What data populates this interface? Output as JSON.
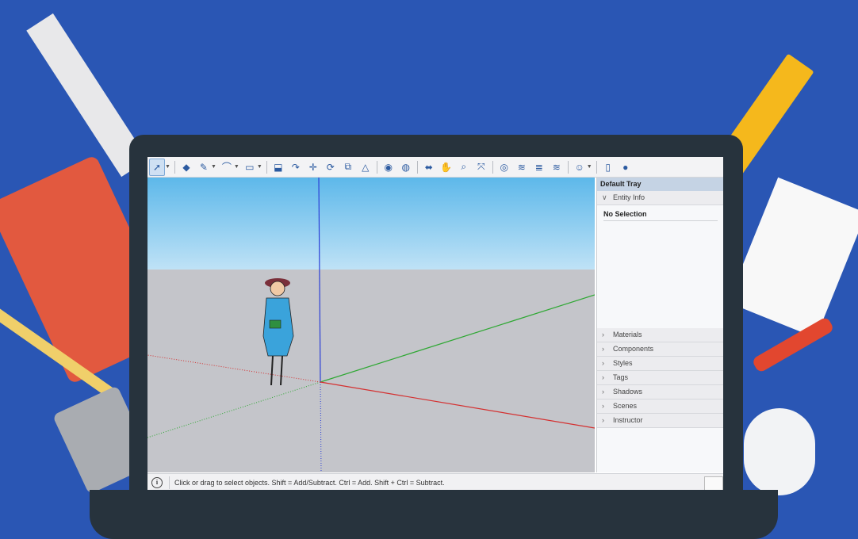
{
  "toolbar": {
    "tools": [
      {
        "name": "select-tool-icon",
        "glyph": "➚"
      },
      {
        "name": "eraser-tool-icon",
        "glyph": "◆"
      },
      {
        "name": "pencil-line-tool-icon",
        "glyph": "✎"
      },
      {
        "name": "arc-tool-icon",
        "glyph": "⌒"
      },
      {
        "name": "rectangle-tool-icon",
        "glyph": "▭"
      },
      {
        "name": "push-pull-tool-icon",
        "glyph": "⬓"
      },
      {
        "name": "follow-me-tool-icon",
        "glyph": "↷"
      },
      {
        "name": "move-tool-icon",
        "glyph": "✛"
      },
      {
        "name": "rotate-tool-icon",
        "glyph": "⟳"
      },
      {
        "name": "scale-tool-icon",
        "glyph": "⧉"
      },
      {
        "name": "offset-tool-icon",
        "glyph": "△"
      },
      {
        "name": "tape-measure-tool-icon",
        "glyph": "◉"
      },
      {
        "name": "paint-bucket-tool-icon",
        "glyph": "◍"
      },
      {
        "name": "orbit-tool-icon",
        "glyph": "⬌"
      },
      {
        "name": "pan-tool-icon",
        "glyph": "✋"
      },
      {
        "name": "zoom-tool-icon",
        "glyph": "⌕"
      },
      {
        "name": "zoom-extents-tool-icon",
        "glyph": "⤧"
      },
      {
        "name": "warehouse-icon",
        "glyph": "◎"
      },
      {
        "name": "extension-warehouse-icon",
        "glyph": "≋"
      },
      {
        "name": "layer-stack-icon",
        "glyph": "≣"
      },
      {
        "name": "extension-manager-icon",
        "glyph": "≋"
      },
      {
        "name": "account-icon",
        "glyph": "☺"
      },
      {
        "name": "new-file-icon",
        "glyph": "▯"
      },
      {
        "name": "user-profile-icon",
        "glyph": "●"
      }
    ]
  },
  "tray": {
    "title": "Default Tray",
    "entity_info": {
      "label": "Entity Info",
      "expanded": true,
      "selection": "No Selection"
    },
    "panels": [
      {
        "label": "Materials"
      },
      {
        "label": "Components"
      },
      {
        "label": "Styles"
      },
      {
        "label": "Tags"
      },
      {
        "label": "Shadows"
      },
      {
        "label": "Scenes"
      },
      {
        "label": "Instructor"
      }
    ]
  },
  "status": {
    "message": "Click or drag to select objects. Shift = Add/Subtract. Ctrl = Add. Shift + Ctrl = Subtract."
  },
  "colors": {
    "background": "#2a56b4",
    "sky_top": "#5db8ea",
    "ground": "#c4c5ca",
    "axis_red": "#d43030",
    "axis_green": "#2fa834",
    "axis_blue": "#2b3fd6"
  }
}
